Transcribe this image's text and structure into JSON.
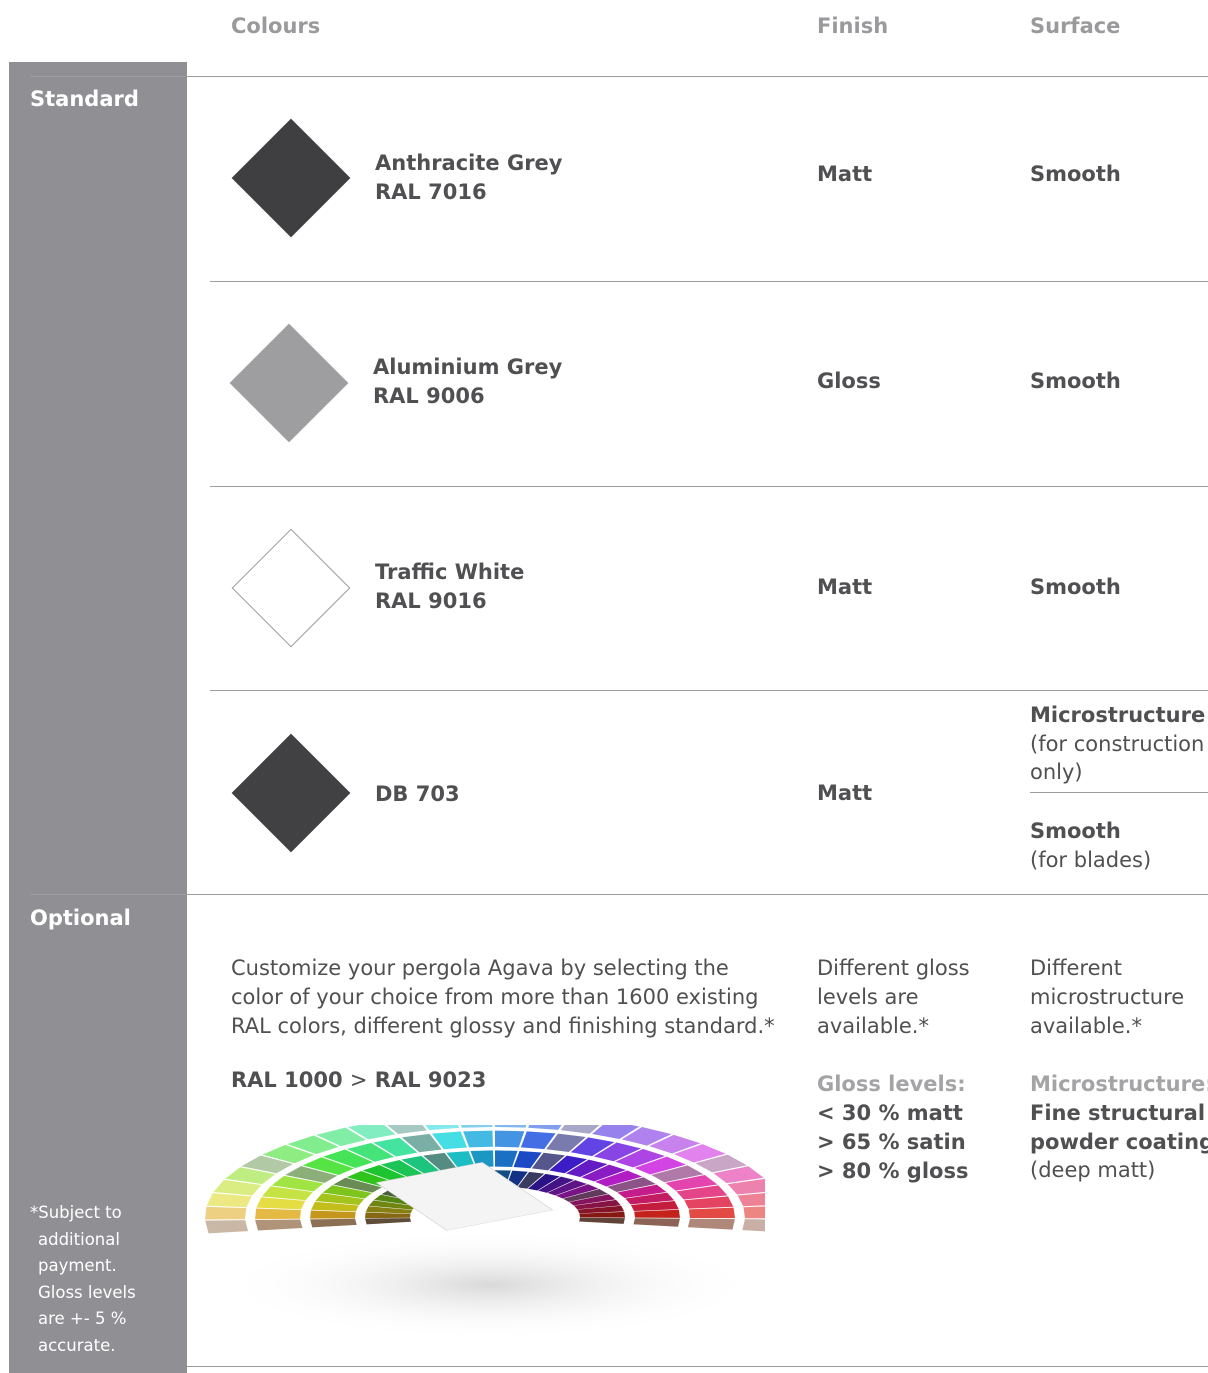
{
  "headers": {
    "colours": "Colours",
    "finish": "Finish",
    "surface": "Surface"
  },
  "sections": {
    "standard": "Standard",
    "optional": "Optional"
  },
  "colors": {
    "anthracite": "#3f3f41",
    "aluminium": "#9e9ea0",
    "white": "#ffffff",
    "db703": "#414143",
    "sidebar": "#909094"
  },
  "rows": [
    {
      "name": "Anthracite Grey",
      "code": "RAL 7016",
      "finish": "Matt",
      "surface": "Smooth"
    },
    {
      "name": "Aluminium Grey",
      "code": "RAL 9006",
      "finish": "Gloss",
      "surface": "Smooth"
    },
    {
      "name": "Traffic White",
      "code": "RAL 9016",
      "finish": "Matt",
      "surface": "Smooth"
    },
    {
      "name": "DB 703",
      "finish": "Matt",
      "surface_a": "Microstructure",
      "surface_a_note_1": "(for construction",
      "surface_a_note_2": "only)",
      "surface_b": "Smooth",
      "surface_b_note": "(for blades)"
    }
  ],
  "optional": {
    "desc_lines": [
      "Customize your pergola Agava by selecting the",
      "color of your choice from more than 1600 existing",
      "RAL colors, different glossy and finishing standard.*"
    ],
    "range_start": "RAL 1000",
    "range_sep": ">",
    "range_end": "RAL 9023",
    "finish_lines": [
      "Different gloss",
      "levels are",
      "available.*"
    ],
    "gloss_title": "Gloss levels:",
    "gloss_items": [
      "< 30 % matt",
      "> 65 % satin",
      "> 80 % gloss"
    ],
    "surface_lines": [
      "Different",
      "microstructure",
      "available.*"
    ],
    "micro_title": "Microstructure:",
    "micro_items": [
      "Fine structural",
      "powder coating"
    ],
    "micro_note": "(deep matt)"
  },
  "footnote": [
    "*Subject to",
    "additional",
    "payment.",
    "Gloss levels",
    "are +- 5 %",
    "accurate."
  ]
}
